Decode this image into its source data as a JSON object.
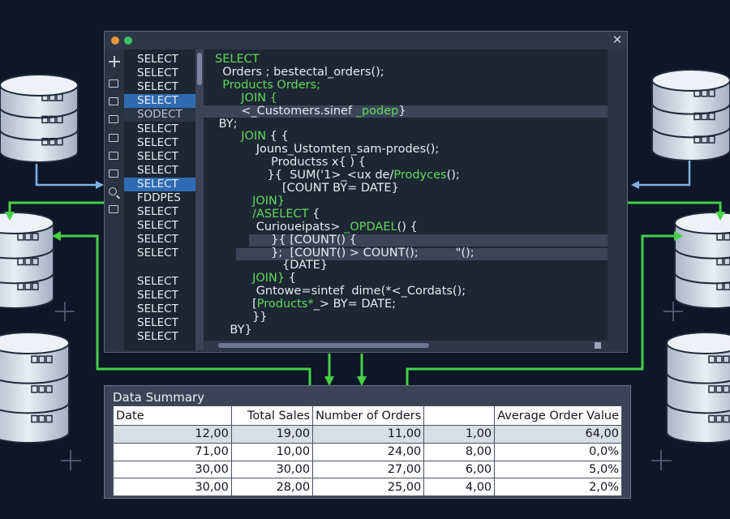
{
  "editor": {
    "sidebar_items": [
      "SELECT",
      "SELECT",
      "SELECT",
      "SELECT",
      "SODECT",
      "SELECT",
      "SELECT",
      "SELECT",
      "SELECT",
      "SELECT",
      "FDDPES",
      "SELECT",
      "SELECT",
      "SELECT",
      "SELECT",
      "",
      "SELECT",
      "SELECT",
      "SELECT",
      "SELECT",
      "SELECT"
    ],
    "code_lines": [
      {
        "pre": "",
        "kw": "SELECT",
        "post": ""
      },
      {
        "pre": "  Orders ; bestectal_orders();",
        "kw": "",
        "post": ""
      },
      {
        "pre": "",
        "kw": "  Products Orders;",
        "post": ""
      },
      {
        "pre": "",
        "kw": "       JOIN {",
        "post": ""
      },
      {
        "pre": "       <_Customers.sinef ",
        "kw": "_podep",
        "post": "}"
      },
      {
        "pre": " BY;",
        "kw": "",
        "post": ""
      },
      {
        "pre": "",
        "kw": "       JOIN",
        "post": " { {"
      },
      {
        "pre": "           Jouns_Ustomten_sam-prodes();",
        "kw": "",
        "post": ""
      },
      {
        "pre": "               Productss x{ ) {",
        "kw": "",
        "post": ""
      },
      {
        "pre": "              }{  SUM('1>_<ux de/",
        "kw": "Prodyces",
        "post": "();"
      },
      {
        "pre": "                  [COUNT BY= DATE}",
        "kw": "",
        "post": ""
      },
      {
        "pre": "",
        "kw": "          JOIN}",
        "post": ""
      },
      {
        "pre": "",
        "kw": "          /ASELECT",
        "post": " {"
      },
      {
        "pre": "           Curioueipats> ",
        "kw": "_OPDAEL",
        "post": "() {"
      },
      {
        "pre": "               }{ [COUNT() {",
        "kw": "",
        "post": ""
      },
      {
        "pre": "               };  [COUNT() > COUNT();          \"();",
        "kw": "",
        "post": ""
      },
      {
        "pre": "                  {DATE}",
        "kw": "",
        "post": ""
      },
      {
        "pre": "",
        "kw": "          JOIN}",
        "post": " {"
      },
      {
        "pre": "           Gntowe=sintef  dime(*<_Cordats();",
        "kw": "",
        "post": ""
      },
      {
        "pre": "          [",
        "kw": "Products*",
        "post": "_> BY= DATE;"
      },
      {
        "pre": "          }}",
        "kw": "",
        "post": ""
      },
      {
        "pre": "    BY}",
        "kw": "",
        "post": ""
      }
    ],
    "close_icon": "close-icon"
  },
  "summary": {
    "title": "Data Summary",
    "columns": [
      "Date",
      "Total Sales",
      "Number of Orders",
      "",
      "Average Order Value"
    ],
    "rows": [
      [
        "12,00",
        "19,00",
        "11,00",
        "1,00",
        "64,00"
      ],
      [
        "71,00",
        "10,00",
        "24,00",
        "8,00",
        "0,0%"
      ],
      [
        "30,00",
        "30,00",
        "27,00",
        "6,00",
        "5,0%"
      ],
      [
        "30,00",
        "28,00",
        "25,00",
        "4,00",
        "2,0%"
      ]
    ]
  },
  "colors": {
    "background": "#0e1628",
    "accent_green": "#46d046",
    "connector_blue": "#7fb2e5",
    "selection_blue": "#2f6bb3"
  }
}
